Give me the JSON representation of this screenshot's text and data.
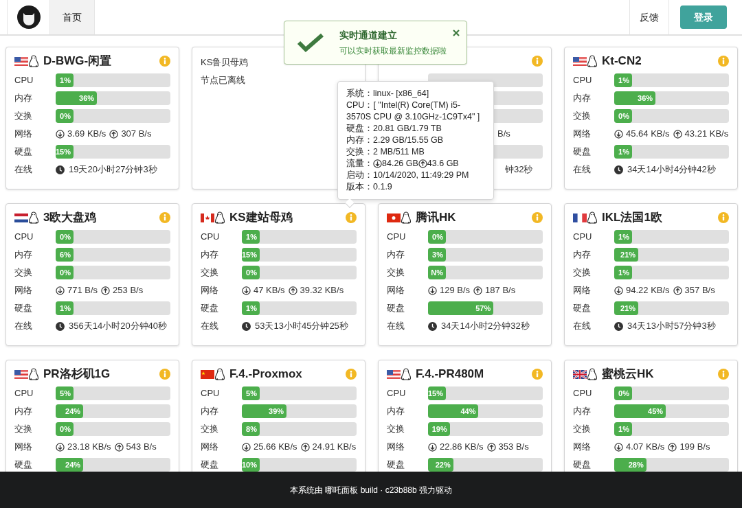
{
  "nav": {
    "tabs": [
      {
        "label": "首页",
        "selected": true
      }
    ],
    "feedback": "反馈",
    "login": "登录"
  },
  "toast": {
    "title": "实时通道建立",
    "message": "可以实时获取最新监控数据啦"
  },
  "servers": [
    {
      "kind": "online",
      "flag": {
        "kind": "us"
      },
      "name": "D-BWG-闲置",
      "rows": [
        {
          "kind": "bar",
          "label": "CPU",
          "text": "1%",
          "level": 0.01
        },
        {
          "kind": "bar",
          "label": "内存",
          "text": "36%",
          "level": 0.36
        },
        {
          "kind": "bar",
          "label": "交换",
          "text": "0%",
          "level": 0
        },
        {
          "kind": "net",
          "label": "网络",
          "down": "3.69 KB/s",
          "up": "307 B/s"
        },
        {
          "kind": "bar",
          "label": "硬盘",
          "text": "15%",
          "level": 0.15
        },
        {
          "kind": "uptime",
          "label": "在线",
          "text": "19天20小时27分钟3秒"
        }
      ]
    },
    {
      "kind": "offline",
      "name": "KS鲁贝母鸡",
      "status": "节点已离线"
    },
    {
      "kind": "partial",
      "rows": [
        {
          "kind": "net",
          "text": "B/s"
        },
        {
          "kind": "uptime",
          "text": "钟32秒"
        }
      ]
    },
    {
      "kind": "online",
      "flag": {
        "kind": "us"
      },
      "name": "Kt-CN2",
      "rows": [
        {
          "kind": "bar",
          "label": "CPU",
          "text": "1%",
          "level": 0.01
        },
        {
          "kind": "bar",
          "label": "内存",
          "text": "36%",
          "level": 0.36
        },
        {
          "kind": "bar",
          "label": "交换",
          "text": "0%",
          "level": 0
        },
        {
          "kind": "net",
          "label": "网络",
          "down": "45.64 KB/s",
          "up": "43.21 KB/s"
        },
        {
          "kind": "bar",
          "label": "硬盘",
          "text": "1%",
          "level": 0.01
        },
        {
          "kind": "uptime",
          "label": "在线",
          "text": "34天14小时4分钟42秒"
        }
      ]
    },
    {
      "kind": "online",
      "flag": {
        "kind": "nl"
      },
      "name": "3欧大盘鸡",
      "rows": [
        {
          "kind": "bar",
          "label": "CPU",
          "text": "0%",
          "level": 0
        },
        {
          "kind": "bar",
          "label": "内存",
          "text": "6%",
          "level": 0.06
        },
        {
          "kind": "bar",
          "label": "交换",
          "text": "0%",
          "level": 0
        },
        {
          "kind": "net",
          "label": "网络",
          "down": "771 B/s",
          "up": "253 B/s"
        },
        {
          "kind": "bar",
          "label": "硬盘",
          "text": "1%",
          "level": 0.01
        },
        {
          "kind": "uptime",
          "label": "在线",
          "text": "356天14小时20分钟40秒"
        }
      ]
    },
    {
      "kind": "online",
      "flag": {
        "kind": "ca"
      },
      "name": "KS建站母鸡",
      "rows": [
        {
          "kind": "bar",
          "label": "CPU",
          "text": "1%",
          "level": 0.01
        },
        {
          "kind": "bar",
          "label": "内存",
          "text": "15%",
          "level": 0.15
        },
        {
          "kind": "bar",
          "label": "交换",
          "text": "0%",
          "level": 0
        },
        {
          "kind": "net",
          "label": "网络",
          "down": "47 KB/s",
          "up": "39.32 KB/s"
        },
        {
          "kind": "bar",
          "label": "硬盘",
          "text": "1%",
          "level": 0.01
        },
        {
          "kind": "uptime",
          "label": "在线",
          "text": "53天13小时45分钟25秒"
        }
      ]
    },
    {
      "kind": "online",
      "flag": {
        "kind": "hk"
      },
      "name": "腾讯HK",
      "rows": [
        {
          "kind": "bar",
          "label": "CPU",
          "text": "0%",
          "level": 0
        },
        {
          "kind": "bar",
          "label": "内存",
          "text": "3%",
          "level": 0.03
        },
        {
          "kind": "bar",
          "label": "交换",
          "text": "N%",
          "level": 0
        },
        {
          "kind": "net",
          "label": "网络",
          "down": "129 B/s",
          "up": "187 B/s"
        },
        {
          "kind": "bar",
          "label": "硬盘",
          "text": "57%",
          "level": 0.57
        },
        {
          "kind": "uptime",
          "label": "在线",
          "text": "34天14小时2分钟32秒"
        }
      ]
    },
    {
      "kind": "online",
      "flag": {
        "kind": "fr"
      },
      "name": "IKL法国1欧",
      "rows": [
        {
          "kind": "bar",
          "label": "CPU",
          "text": "1%",
          "level": 0.01
        },
        {
          "kind": "bar",
          "label": "内存",
          "text": "21%",
          "level": 0.21
        },
        {
          "kind": "bar",
          "label": "交换",
          "text": "1%",
          "level": 0.01
        },
        {
          "kind": "net",
          "label": "网络",
          "down": "94.22 KB/s",
          "up": "357 B/s"
        },
        {
          "kind": "bar",
          "label": "硬盘",
          "text": "21%",
          "level": 0.21
        },
        {
          "kind": "uptime",
          "label": "在线",
          "text": "34天13小时57分钟3秒"
        }
      ]
    },
    {
      "kind": "online",
      "flag": {
        "kind": "us"
      },
      "name": "PR洛杉矶1G",
      "rows": [
        {
          "kind": "bar",
          "label": "CPU",
          "text": "5%",
          "level": 0.05
        },
        {
          "kind": "bar",
          "label": "内存",
          "text": "24%",
          "level": 0.24
        },
        {
          "kind": "bar",
          "label": "交换",
          "text": "0%",
          "level": 0
        },
        {
          "kind": "net",
          "label": "网络",
          "down": "23.18 KB/s",
          "up": "543 B/s"
        },
        {
          "kind": "bar",
          "label": "硬盘",
          "text": "24%",
          "level": 0.24
        }
      ]
    },
    {
      "kind": "online",
      "flag": {
        "kind": "cn"
      },
      "name": "F.4.-Proxmox",
      "rows": [
        {
          "kind": "bar",
          "label": "CPU",
          "text": "5%",
          "level": 0.05
        },
        {
          "kind": "bar",
          "label": "内存",
          "text": "39%",
          "level": 0.39
        },
        {
          "kind": "bar",
          "label": "交换",
          "text": "8%",
          "level": 0.08
        },
        {
          "kind": "net",
          "label": "网络",
          "down": "25.66 KB/s",
          "up": "24.91 KB/s"
        },
        {
          "kind": "bar",
          "label": "硬盘",
          "text": "10%",
          "level": 0.1
        }
      ]
    },
    {
      "kind": "online",
      "flag": {
        "kind": "us"
      },
      "name": "F.4.-PR480M",
      "rows": [
        {
          "kind": "bar",
          "label": "CPU",
          "text": "15%",
          "level": 0.15
        },
        {
          "kind": "bar",
          "label": "内存",
          "text": "44%",
          "level": 0.44
        },
        {
          "kind": "bar",
          "label": "交换",
          "text": "19%",
          "level": 0.19
        },
        {
          "kind": "net",
          "label": "网络",
          "down": "22.86 KB/s",
          "up": "353 B/s"
        },
        {
          "kind": "bar",
          "label": "硬盘",
          "text": "22%",
          "level": 0.22
        }
      ]
    },
    {
      "kind": "online",
      "flag": {
        "kind": "gb"
      },
      "name": "蜜桃云HK",
      "rows": [
        {
          "kind": "bar",
          "label": "CPU",
          "text": "0%",
          "level": 0
        },
        {
          "kind": "bar",
          "label": "内存",
          "text": "45%",
          "level": 0.45
        },
        {
          "kind": "bar",
          "label": "交换",
          "text": "1%",
          "level": 0.01
        },
        {
          "kind": "net",
          "label": "网络",
          "down": "4.07 KB/s",
          "up": "199 B/s"
        },
        {
          "kind": "bar",
          "label": "硬盘",
          "text": "28%",
          "level": 0.28
        }
      ]
    }
  ],
  "tooltip": {
    "rows": [
      {
        "kind": "text",
        "label": "系统：",
        "value": "linux- [x86_64]"
      },
      {
        "kind": "text",
        "label": "CPU：",
        "value": "[ \"Intel(R) Core(TM) i5-3570S CPU @ 3.10GHz-1C9Tx4\" ]"
      },
      {
        "kind": "text",
        "label": "硬盘：",
        "value": "20.81 GB/1.79 TB"
      },
      {
        "kind": "text",
        "label": "内存：",
        "value": "2.29 GB/15.55 GB"
      },
      {
        "kind": "text",
        "label": "交换：",
        "value": "2 MB/511 MB"
      },
      {
        "kind": "traffic",
        "label": "流量：",
        "down": "84.26 GB",
        "up": "43.6 GB"
      },
      {
        "kind": "text",
        "label": "启动：",
        "value": "10/14/2020, 11:49:29 PM"
      },
      {
        "kind": "text",
        "label": "版本：",
        "value": "0.1.9"
      }
    ]
  },
  "footer": "本系统由 哪吒面板 build · c23b88b 强力驱动"
}
